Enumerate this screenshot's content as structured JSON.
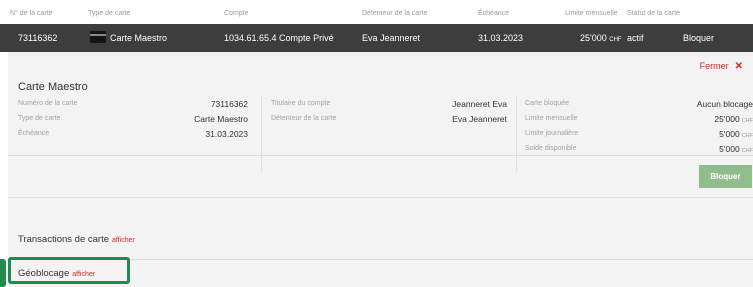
{
  "table_header": {
    "card_no": "N° de la carte",
    "card_type": "Type de carte",
    "account": "Compte",
    "holder": "Détenteur de la carte",
    "expiry": "Échéance",
    "monthly_limit": "Limite mensuelle",
    "status": "Statut de la carte"
  },
  "card_row": {
    "card_no": "73116362",
    "card_type": "Carte Maestro",
    "account": "1034.61.65.4 Compte Privé",
    "holder": "Eva Jeanneret",
    "expiry": "31.03.2023",
    "monthly_limit": "25'000",
    "currency": "CHF",
    "status": "actif",
    "block_button": "Bloquer"
  },
  "detail": {
    "close_label": "Fermer",
    "close_icon": "close-x-icon",
    "title": "Carte Maestro",
    "col1": [
      {
        "label": "Numéro de la carte",
        "value": "73116362"
      },
      {
        "label": "Type de carte",
        "value": "Carte Maestro"
      },
      {
        "label": "Échéance",
        "value": "31.03.2023"
      }
    ],
    "col2": [
      {
        "label": "Titulaire du compte",
        "value": "Jeanneret Eva"
      },
      {
        "label": "Détenteur de la carte",
        "value": "Eva Jeanneret"
      }
    ],
    "col3": [
      {
        "label": "Carte bloquée",
        "value": "Aucun blocage",
        "currency": ""
      },
      {
        "label": "Limite mensuelle",
        "value": "25'000",
        "currency": "CHF"
      },
      {
        "label": "Limite journalière",
        "value": "5'000",
        "currency": "CHF"
      },
      {
        "label": "Solde disponible",
        "value": "5'000",
        "currency": "CHF"
      }
    ],
    "block_button": "Bloquer"
  },
  "transactions": {
    "title": "Transactions de carte",
    "link": "afficher"
  },
  "geoblocking": {
    "title": "Géoblocage",
    "link": "afficher"
  },
  "colors": {
    "accent_red": "#d42a1f",
    "button_green": "#8fbd8b",
    "highlight_green": "#1f8b4c",
    "row_dark": "#3d3d3d"
  }
}
